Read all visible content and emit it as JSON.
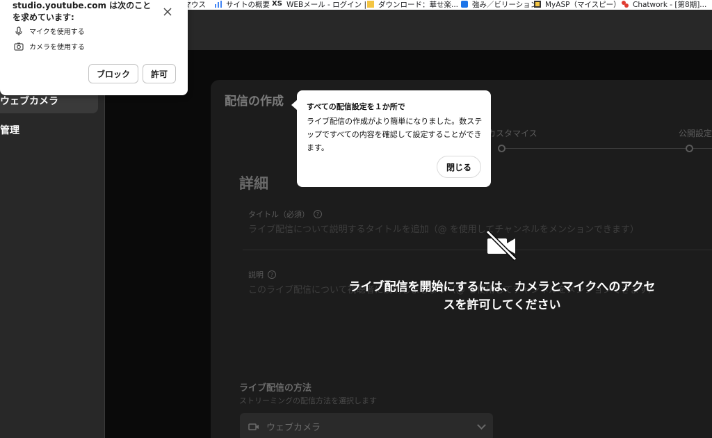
{
  "bookmarks": [
    {
      "label": "ンマウス"
    },
    {
      "label": "サイトの概要"
    },
    {
      "label": "WEBメール - ログイン |..."
    },
    {
      "label": "ダウンロード：華せ楽..."
    },
    {
      "label": "強み／ビリーション"
    },
    {
      "label": "MyASP（マイスピー）"
    },
    {
      "label": "Chatwork - [第8期]..."
    }
  ],
  "permission": {
    "title": "studio.youtube.com は次のことを求めています:",
    "items": [
      "マイクを使用する",
      "カメラを使用する"
    ],
    "block_label": "ブロック",
    "allow_label": "許可"
  },
  "sidebar": {
    "items": [
      {
        "label": "ウェブカメラ",
        "active": true
      },
      {
        "label": "管理",
        "active": false
      }
    ]
  },
  "panel": {
    "title": "配信の作成",
    "steps": [
      "カスタマイス",
      "公開設定"
    ],
    "details_title": "詳細",
    "title_field": {
      "label": "タイトル（必須）",
      "placeholder": "ライブ配信について説明するタイトルを追加（@ を使用してチャンネルをメンションできます）"
    },
    "desc_field": {
      "label": "説明",
      "placeholder": "このライブ配信について視聴者に説明しましょう（@ を使用してチャンネルをメンションできます）"
    },
    "method_title": "ライブ配信の方法",
    "method_sub": "ストリーミングの配信方法を選択します",
    "method_value": "ウェブカメラ"
  },
  "camera_message": {
    "line1": "ライブ配信を開始にするには、カメラとマイクへのアクセ",
    "line2": "スを許可してください"
  },
  "tooltip": {
    "title": "すべての配信設定を１か所で",
    "body": "ライブ配信の作成がより簡単になりました。数ステップですべての内容を確認して設定することができます。",
    "close_label": "閉じる"
  }
}
